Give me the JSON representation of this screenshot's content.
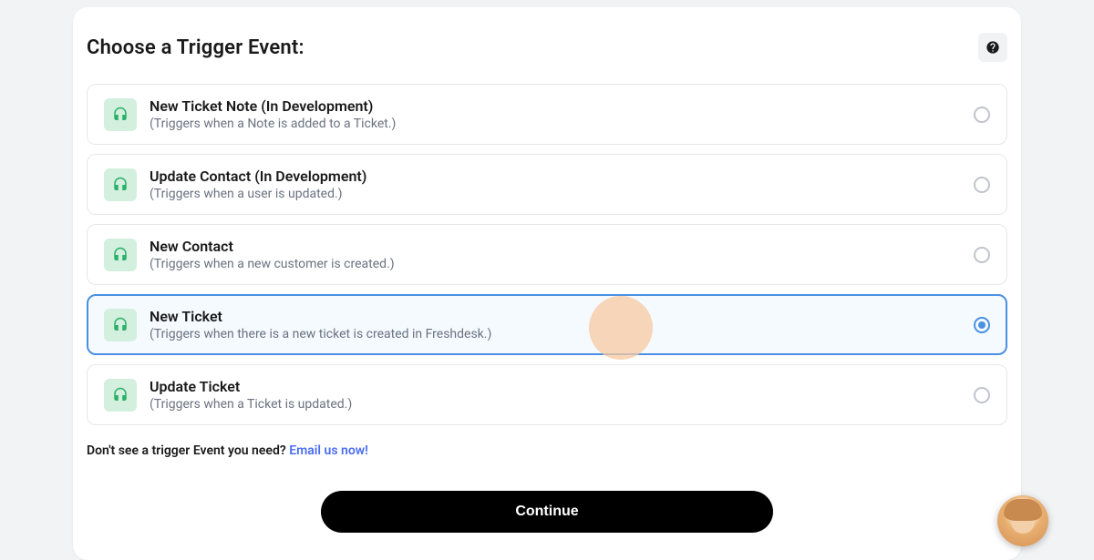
{
  "header": {
    "title": "Choose a Trigger Event:"
  },
  "options": [
    {
      "title": "New Ticket Note (In Development)",
      "desc": "(Triggers when a Note is added to a Ticket.)",
      "selected": false
    },
    {
      "title": "Update Contact (In Development)",
      "desc": "(Triggers when a user is updated.)",
      "selected": false
    },
    {
      "title": "New Contact",
      "desc": "(Triggers when a new customer is created.)",
      "selected": false
    },
    {
      "title": "New Ticket",
      "desc": "(Triggers when there is a new ticket is created in Freshdesk.)",
      "selected": true
    },
    {
      "title": "Update Ticket",
      "desc": "(Triggers when a Ticket is updated.)",
      "selected": false
    }
  ],
  "footer": {
    "prompt": "Don't see a trigger Event you need? ",
    "link_text": "Email us now!"
  },
  "continue_label": "Continue"
}
